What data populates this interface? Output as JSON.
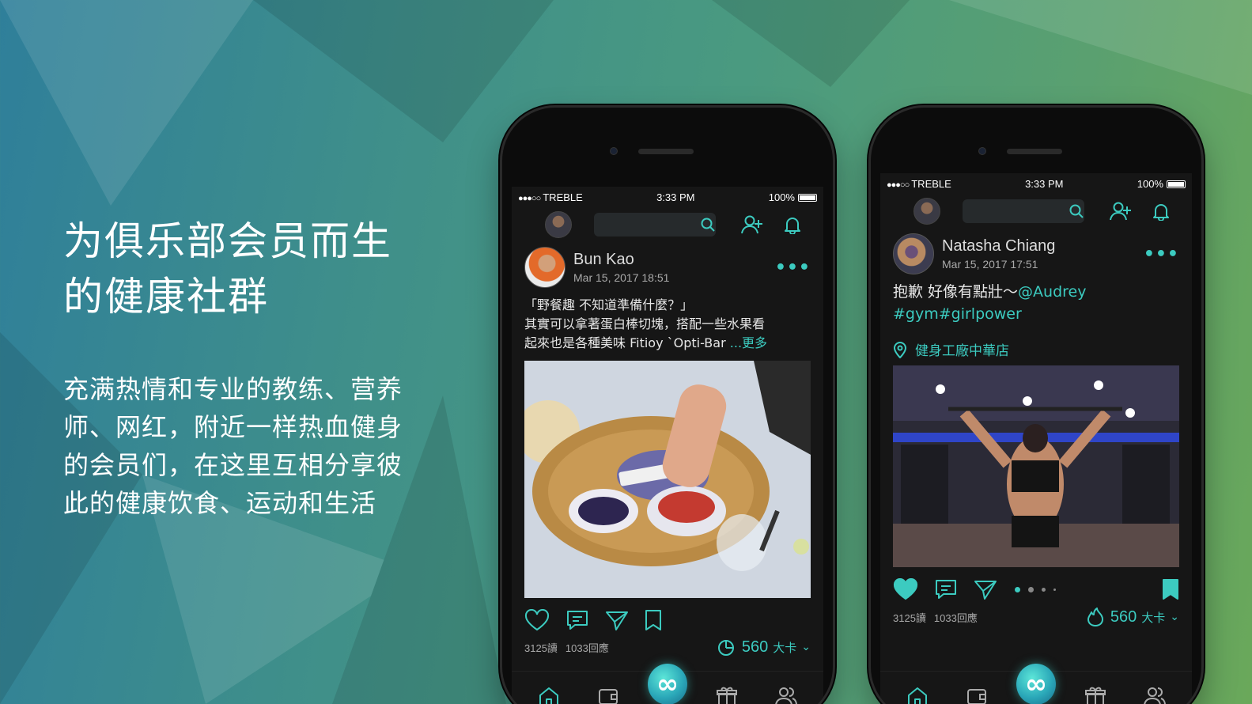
{
  "colors": {
    "accent": "#3ccbc0",
    "screen_bg": "#161616",
    "page_gradient_left": "#2f7f9a",
    "page_gradient_right": "#6aa85a"
  },
  "hero": {
    "title_lines": [
      "为俱乐部会员而生",
      "的健康社群"
    ],
    "desc_lines": [
      "充满热情和专业的教练、营养",
      "师、网红，附近一样热血健身",
      "的会员们，在这里互相分享彼",
      "此的健康饮食、运动和生活"
    ]
  },
  "phones": [
    {
      "status": {
        "carrier": "TREBLE",
        "signal": "●●●○○",
        "time": "3:33 PM",
        "battery": "100%"
      },
      "nav": {
        "avatar_icon": "user-avatar",
        "search_icon": "search-icon",
        "add_user_icon": "add-user-icon",
        "bell_icon": "bell-icon"
      },
      "post": {
        "author": "Bun Kao",
        "date": "Mar 15, 2017  18:51",
        "more": "•••",
        "text_lines": [
          "「野餐趣 不知道準備什麼？」",
          "其實可以拿著蛋白棒切塊，搭配一些水果看",
          "起來也是各種美味 Fitioy `Opti-Bar "
        ],
        "more_link": "...更多",
        "photo": "picnic basket with fruit and protein bar",
        "reads": "3125讀",
        "replies": "1033回應",
        "kcal_value": "560",
        "kcal_unit": "大卡",
        "kcal_chevron": "⌄"
      },
      "tabs": [
        "home-icon",
        "wallet-icon",
        "infinity-button",
        "gift-icon",
        "members-icon"
      ],
      "center_glyph": "∞"
    },
    {
      "status": {
        "carrier": "TREBLE",
        "signal": "●●●○○",
        "time": "3:33 PM",
        "battery": "100%"
      },
      "nav": {
        "avatar_icon": "user-avatar",
        "search_icon": "search-icon",
        "add_user_icon": "add-user-icon",
        "bell_icon": "bell-icon"
      },
      "post": {
        "author": "Natasha Chiang",
        "date": "Mar 15, 2017  17:51",
        "more": "•••",
        "text_plain": "抱歉 好像有點壯～",
        "mention": "@Audrey",
        "hashtags": "#gym#girlpower",
        "location": "健身工廠中華店",
        "photo": "woman training at gym lat pulldown machine",
        "reads": "3125讀",
        "replies": "1033回應",
        "kcal_value": "560",
        "kcal_unit": "大卡",
        "kcal_chevron": "⌄"
      },
      "tabs": [
        "home-icon",
        "wallet-icon",
        "infinity-button",
        "gift-icon",
        "members-icon"
      ],
      "center_glyph": "∞"
    }
  ]
}
